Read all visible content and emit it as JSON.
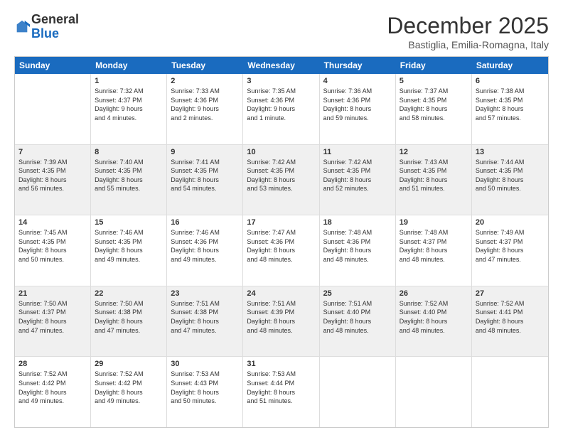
{
  "logo": {
    "general": "General",
    "blue": "Blue"
  },
  "header": {
    "month": "December 2025",
    "location": "Bastiglia, Emilia-Romagna, Italy"
  },
  "weekdays": [
    "Sunday",
    "Monday",
    "Tuesday",
    "Wednesday",
    "Thursday",
    "Friday",
    "Saturday"
  ],
  "rows": [
    [
      {
        "day": "",
        "text": ""
      },
      {
        "day": "1",
        "text": "Sunrise: 7:32 AM\nSunset: 4:37 PM\nDaylight: 9 hours\nand 4 minutes."
      },
      {
        "day": "2",
        "text": "Sunrise: 7:33 AM\nSunset: 4:36 PM\nDaylight: 9 hours\nand 2 minutes."
      },
      {
        "day": "3",
        "text": "Sunrise: 7:35 AM\nSunset: 4:36 PM\nDaylight: 9 hours\nand 1 minute."
      },
      {
        "day": "4",
        "text": "Sunrise: 7:36 AM\nSunset: 4:36 PM\nDaylight: 8 hours\nand 59 minutes."
      },
      {
        "day": "5",
        "text": "Sunrise: 7:37 AM\nSunset: 4:35 PM\nDaylight: 8 hours\nand 58 minutes."
      },
      {
        "day": "6",
        "text": "Sunrise: 7:38 AM\nSunset: 4:35 PM\nDaylight: 8 hours\nand 57 minutes."
      }
    ],
    [
      {
        "day": "7",
        "text": "Sunrise: 7:39 AM\nSunset: 4:35 PM\nDaylight: 8 hours\nand 56 minutes."
      },
      {
        "day": "8",
        "text": "Sunrise: 7:40 AM\nSunset: 4:35 PM\nDaylight: 8 hours\nand 55 minutes."
      },
      {
        "day": "9",
        "text": "Sunrise: 7:41 AM\nSunset: 4:35 PM\nDaylight: 8 hours\nand 54 minutes."
      },
      {
        "day": "10",
        "text": "Sunrise: 7:42 AM\nSunset: 4:35 PM\nDaylight: 8 hours\nand 53 minutes."
      },
      {
        "day": "11",
        "text": "Sunrise: 7:42 AM\nSunset: 4:35 PM\nDaylight: 8 hours\nand 52 minutes."
      },
      {
        "day": "12",
        "text": "Sunrise: 7:43 AM\nSunset: 4:35 PM\nDaylight: 8 hours\nand 51 minutes."
      },
      {
        "day": "13",
        "text": "Sunrise: 7:44 AM\nSunset: 4:35 PM\nDaylight: 8 hours\nand 50 minutes."
      }
    ],
    [
      {
        "day": "14",
        "text": "Sunrise: 7:45 AM\nSunset: 4:35 PM\nDaylight: 8 hours\nand 50 minutes."
      },
      {
        "day": "15",
        "text": "Sunrise: 7:46 AM\nSunset: 4:35 PM\nDaylight: 8 hours\nand 49 minutes."
      },
      {
        "day": "16",
        "text": "Sunrise: 7:46 AM\nSunset: 4:36 PM\nDaylight: 8 hours\nand 49 minutes."
      },
      {
        "day": "17",
        "text": "Sunrise: 7:47 AM\nSunset: 4:36 PM\nDaylight: 8 hours\nand 48 minutes."
      },
      {
        "day": "18",
        "text": "Sunrise: 7:48 AM\nSunset: 4:36 PM\nDaylight: 8 hours\nand 48 minutes."
      },
      {
        "day": "19",
        "text": "Sunrise: 7:48 AM\nSunset: 4:37 PM\nDaylight: 8 hours\nand 48 minutes."
      },
      {
        "day": "20",
        "text": "Sunrise: 7:49 AM\nSunset: 4:37 PM\nDaylight: 8 hours\nand 47 minutes."
      }
    ],
    [
      {
        "day": "21",
        "text": "Sunrise: 7:50 AM\nSunset: 4:37 PM\nDaylight: 8 hours\nand 47 minutes."
      },
      {
        "day": "22",
        "text": "Sunrise: 7:50 AM\nSunset: 4:38 PM\nDaylight: 8 hours\nand 47 minutes."
      },
      {
        "day": "23",
        "text": "Sunrise: 7:51 AM\nSunset: 4:38 PM\nDaylight: 8 hours\nand 47 minutes."
      },
      {
        "day": "24",
        "text": "Sunrise: 7:51 AM\nSunset: 4:39 PM\nDaylight: 8 hours\nand 48 minutes."
      },
      {
        "day": "25",
        "text": "Sunrise: 7:51 AM\nSunset: 4:40 PM\nDaylight: 8 hours\nand 48 minutes."
      },
      {
        "day": "26",
        "text": "Sunrise: 7:52 AM\nSunset: 4:40 PM\nDaylight: 8 hours\nand 48 minutes."
      },
      {
        "day": "27",
        "text": "Sunrise: 7:52 AM\nSunset: 4:41 PM\nDaylight: 8 hours\nand 48 minutes."
      }
    ],
    [
      {
        "day": "28",
        "text": "Sunrise: 7:52 AM\nSunset: 4:42 PM\nDaylight: 8 hours\nand 49 minutes."
      },
      {
        "day": "29",
        "text": "Sunrise: 7:52 AM\nSunset: 4:42 PM\nDaylight: 8 hours\nand 49 minutes."
      },
      {
        "day": "30",
        "text": "Sunrise: 7:53 AM\nSunset: 4:43 PM\nDaylight: 8 hours\nand 50 minutes."
      },
      {
        "day": "31",
        "text": "Sunrise: 7:53 AM\nSunset: 4:44 PM\nDaylight: 8 hours\nand 51 minutes."
      },
      {
        "day": "",
        "text": ""
      },
      {
        "day": "",
        "text": ""
      },
      {
        "day": "",
        "text": ""
      }
    ]
  ]
}
